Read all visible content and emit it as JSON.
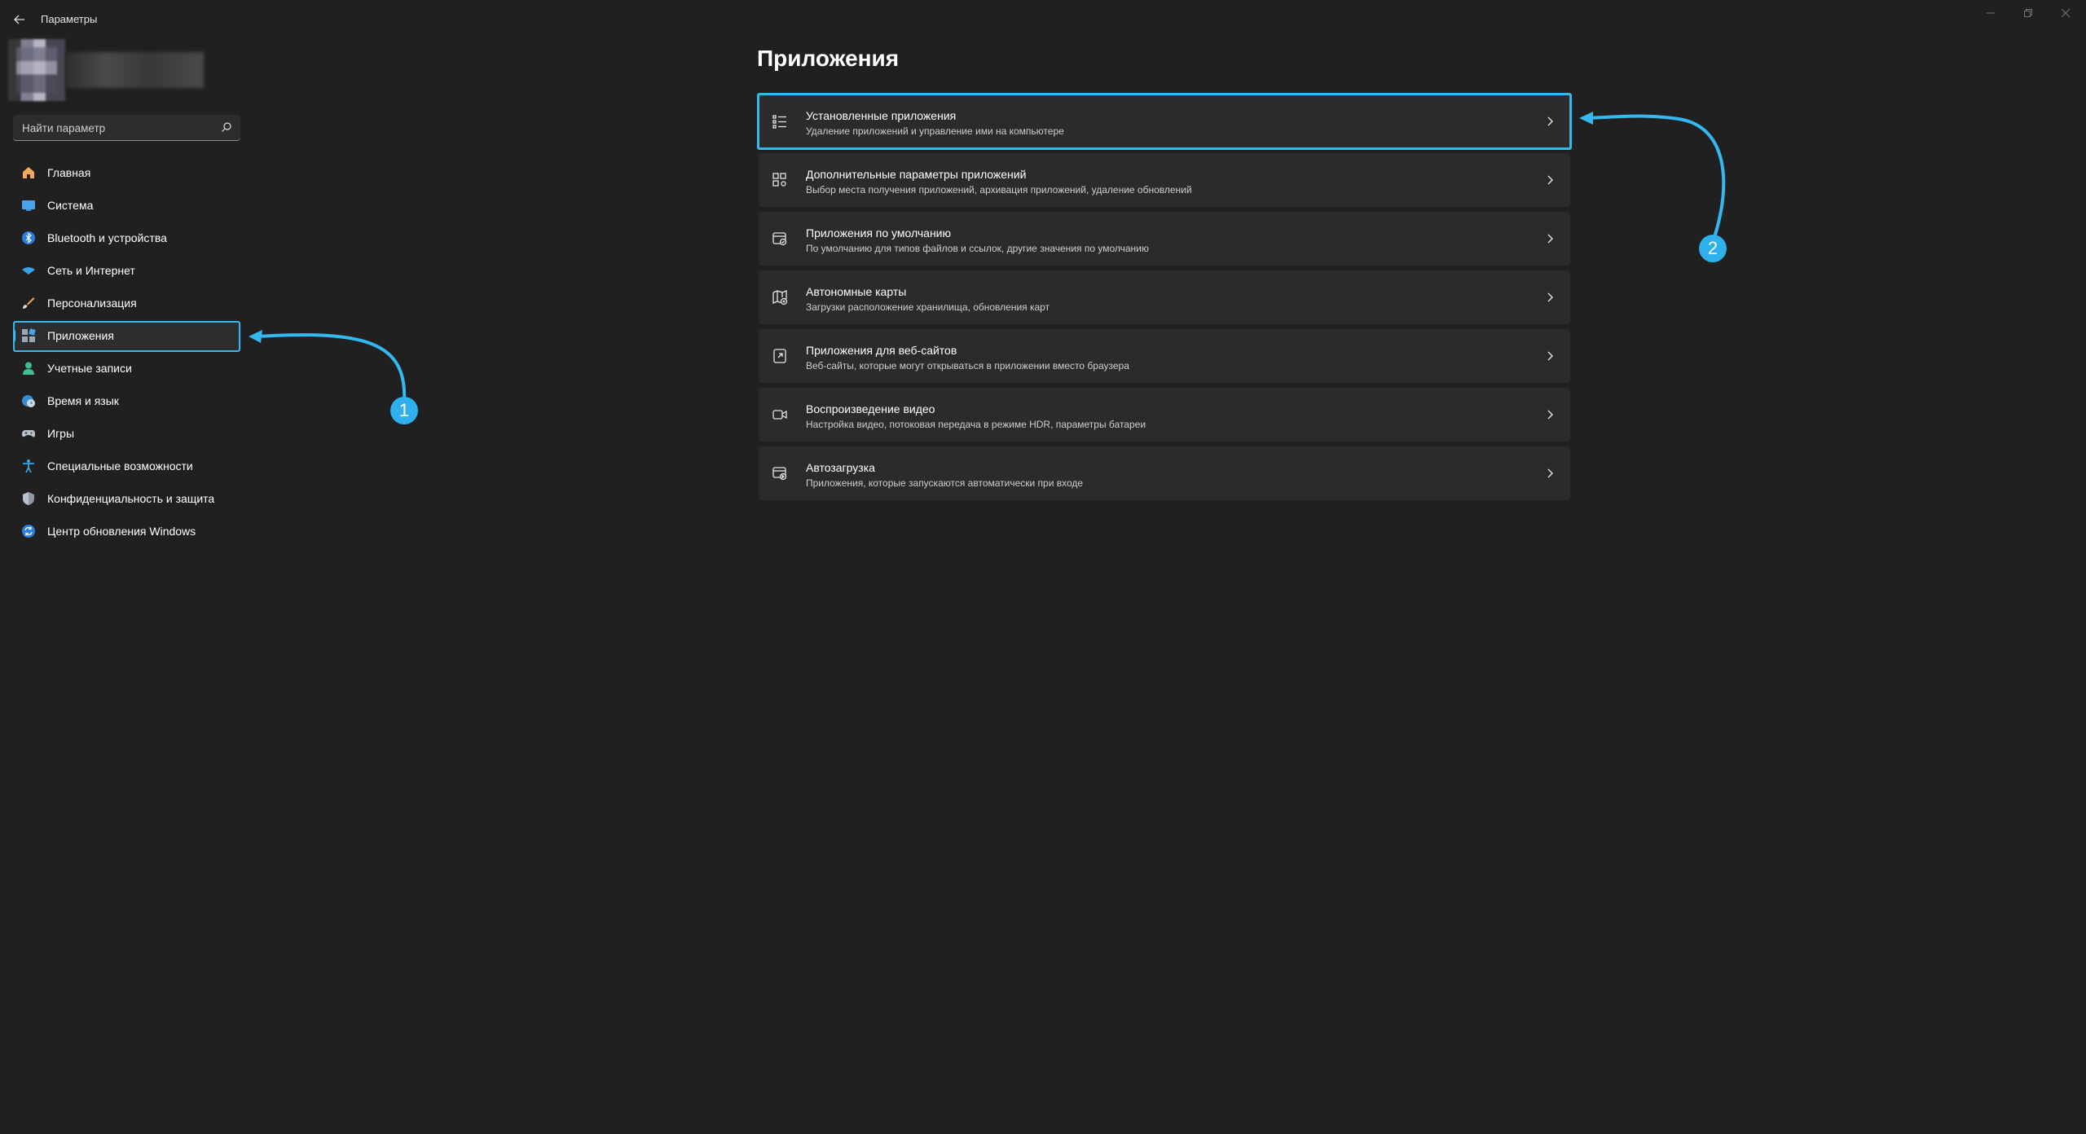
{
  "window": {
    "title": "Параметры",
    "controls": [
      "minimize-icon",
      "restore-icon",
      "close-icon"
    ]
  },
  "search": {
    "placeholder": "Найти параметр"
  },
  "sidebar": {
    "items": [
      {
        "label": "Главная",
        "icon": "home-icon"
      },
      {
        "label": "Система",
        "icon": "system-icon"
      },
      {
        "label": "Bluetooth и устройства",
        "icon": "bluetooth-icon"
      },
      {
        "label": "Сеть и Интернет",
        "icon": "wifi-icon"
      },
      {
        "label": "Персонализация",
        "icon": "brush-icon"
      },
      {
        "label": "Приложения",
        "icon": "apps-icon",
        "active": true
      },
      {
        "label": "Учетные записи",
        "icon": "account-icon"
      },
      {
        "label": "Время и язык",
        "icon": "time-language-icon"
      },
      {
        "label": "Игры",
        "icon": "gamepad-icon"
      },
      {
        "label": "Специальные возможности",
        "icon": "accessibility-icon"
      },
      {
        "label": "Конфиденциальность и защита",
        "icon": "shield-icon"
      },
      {
        "label": "Центр обновления Windows",
        "icon": "update-icon"
      }
    ]
  },
  "main": {
    "title": "Приложения",
    "cards": [
      {
        "title": "Установленные приложения",
        "subtitle": "Удаление приложений и управление ими на компьютере",
        "icon": "installed-apps-icon"
      },
      {
        "title": "Дополнительные параметры приложений",
        "subtitle": "Выбор места получения приложений, архивация приложений, удаление обновлений",
        "icon": "advanced-apps-icon"
      },
      {
        "title": "Приложения по умолчанию",
        "subtitle": "По умолчанию для типов файлов и ссылок, другие значения по умолчанию",
        "icon": "default-apps-icon"
      },
      {
        "title": "Автономные карты",
        "subtitle": "Загрузки расположение хранилища, обновления карт",
        "icon": "offline-maps-icon"
      },
      {
        "title": "Приложения для веб-сайтов",
        "subtitle": "Веб-сайты, которые могут открываться в приложении вместо браузера",
        "icon": "web-apps-icon"
      },
      {
        "title": "Воспроизведение видео",
        "subtitle": "Настройка видео, потоковая передача в режиме HDR, параметры батареи",
        "icon": "video-icon"
      },
      {
        "title": "Автозагрузка",
        "subtitle": "Приложения, которые запускаются автоматически при входе",
        "icon": "startup-icon"
      }
    ]
  },
  "annotations": {
    "badge1": "1",
    "badge2": "2",
    "color": "#35b8f0"
  }
}
